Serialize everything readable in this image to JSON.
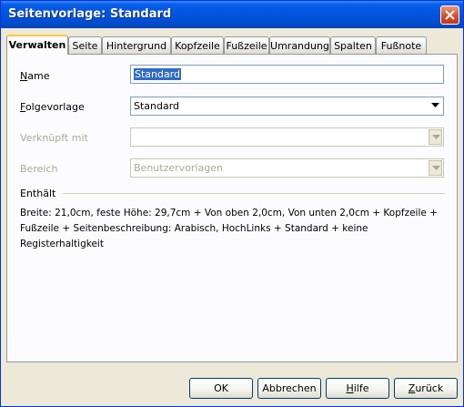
{
  "window": {
    "title": "Seitenvorlage: Standard"
  },
  "tabs": [
    {
      "label": "Verwalten",
      "active": true
    },
    {
      "label": "Seite"
    },
    {
      "label": "Hintergrund"
    },
    {
      "label": "Kopfzeile"
    },
    {
      "label": "Fußzeile"
    },
    {
      "label": "Umrandung"
    },
    {
      "label": "Spalten"
    },
    {
      "label": "Fußnote"
    }
  ],
  "form": {
    "name": {
      "label_first": "N",
      "label_rest": "ame",
      "value": "Standard"
    },
    "folge": {
      "label_first": "F",
      "label_rest": "olgevorlage",
      "value": "Standard"
    },
    "verknuepft": {
      "label": "Verknüpft mit",
      "value": ""
    },
    "bereich": {
      "label": "Bereich",
      "value": "Benutzervorlagen"
    }
  },
  "contains": {
    "heading": "Enthält",
    "text": "Breite: 21,0cm, feste Höhe: 29,7cm + Von oben 2,0cm, Von unten 2,0cm + Kopfzeile + Fußzeile + Seitenbeschreibung: Arabisch, HochLinks + Standard + keine Registerhaltigkeit"
  },
  "buttons": {
    "ok": "OK",
    "cancel": "Abbrechen",
    "help_first": "H",
    "help_rest": "ilfe",
    "back_first": "Z",
    "back_rest": "urück"
  },
  "colors": {
    "titlebar": "#0355e0",
    "selection": "#316ac5",
    "dialog_bg": "#ece9d8"
  }
}
